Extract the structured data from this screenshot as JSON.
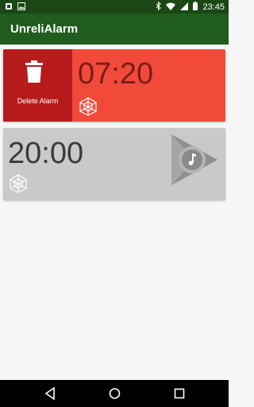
{
  "status_bar": {
    "time": "23:45",
    "left_icons": [
      "notification-icon",
      "image-icon"
    ],
    "right_icons": [
      "bluetooth-icon",
      "wifi-icon",
      "signal-icon",
      "battery-icon"
    ]
  },
  "app": {
    "title": "UnreliAlarm"
  },
  "alarms": [
    {
      "time": "07:20",
      "delete_label": "Delete Alarm",
      "background": "#f14a3a",
      "delete_background": "#b71b1b",
      "badge_icon": "web-spider-icon"
    },
    {
      "time": "20:00",
      "background": "#c9c9c9",
      "badge_icon": "web-spider-icon",
      "sound_icon": "play-music-icon"
    }
  ],
  "nav": {
    "buttons": [
      "back-icon",
      "home-icon",
      "recents-icon"
    ]
  },
  "colors": {
    "status_bar": "#1a4714",
    "app_bar": "#205c1d"
  }
}
